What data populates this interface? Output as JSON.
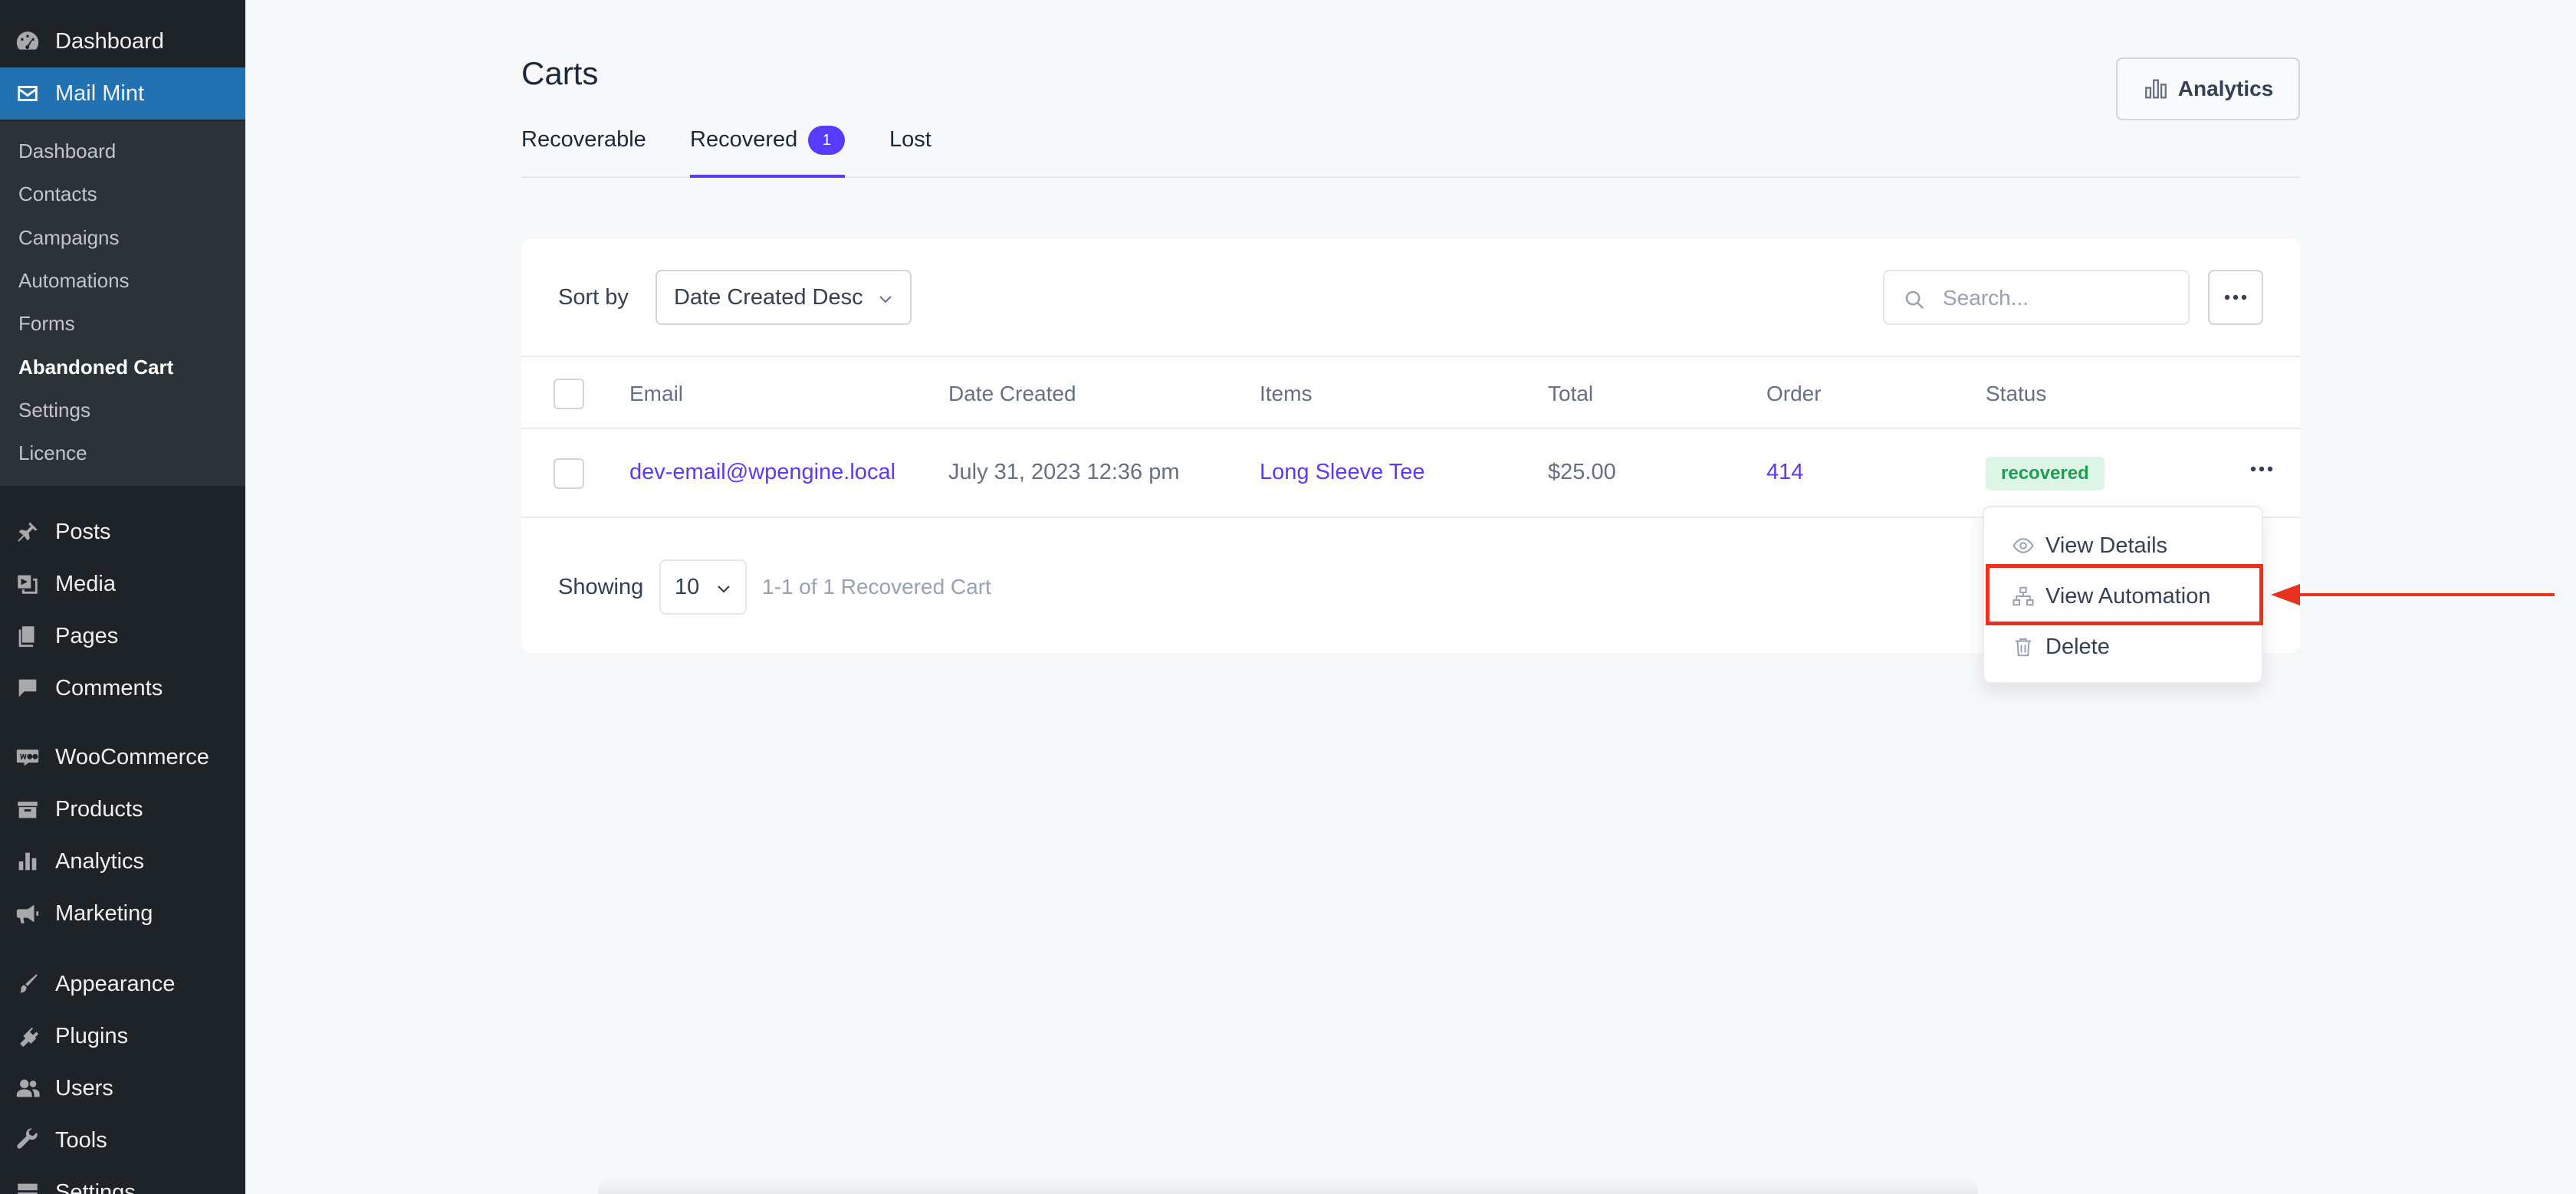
{
  "sidebar": {
    "top_items": [
      {
        "label": "Dashboard",
        "icon": "dashboard-icon"
      },
      {
        "label": "Mail Mint",
        "icon": "mail-icon",
        "active": true
      }
    ],
    "submenu": [
      "Dashboard",
      "Contacts",
      "Campaigns",
      "Automations",
      "Forms",
      "Abandoned Cart",
      "Settings",
      "Licence"
    ],
    "current_submenu": "Abandoned Cart",
    "items": [
      {
        "label": "Posts",
        "icon": "pin-icon"
      },
      {
        "label": "Media",
        "icon": "media-icon"
      },
      {
        "label": "Pages",
        "icon": "pages-icon"
      },
      {
        "label": "Comments",
        "icon": "comments-icon"
      },
      {
        "label": "WooCommerce",
        "icon": "woo-icon"
      },
      {
        "label": "Products",
        "icon": "products-icon"
      },
      {
        "label": "Analytics",
        "icon": "bar-chart-icon"
      },
      {
        "label": "Marketing",
        "icon": "megaphone-icon"
      },
      {
        "label": "Appearance",
        "icon": "brush-icon"
      },
      {
        "label": "Plugins",
        "icon": "plug-icon"
      },
      {
        "label": "Users",
        "icon": "users-icon"
      },
      {
        "label": "Tools",
        "icon": "wrench-icon"
      },
      {
        "label": "Settings",
        "icon": "settings-icon"
      }
    ]
  },
  "header": {
    "title": "Carts",
    "analytics_label": "Analytics"
  },
  "tabs": [
    {
      "label": "Recoverable"
    },
    {
      "label": "Recovered",
      "count": "1",
      "active": true
    },
    {
      "label": "Lost"
    }
  ],
  "toolbar": {
    "sort_label": "Sort by",
    "sort_value": "Date Created Desc",
    "search_placeholder": "Search..."
  },
  "table": {
    "columns": [
      "Email",
      "Date Created",
      "Items",
      "Total",
      "Order",
      "Status"
    ],
    "rows": [
      {
        "email": "dev-email@wpengine.local",
        "date_created": "July 31, 2023 12:36 pm",
        "items": "Long Sleeve Tee",
        "total": "$25.00",
        "order": "414",
        "status": "recovered"
      }
    ]
  },
  "pagination": {
    "showing_label": "Showing",
    "per_page": "10",
    "range_text": "1-1 of 1 Recovered Cart"
  },
  "row_menu": {
    "items": [
      {
        "label": "View Details",
        "icon": "eye-icon"
      },
      {
        "label": "View Automation",
        "icon": "sitemap-icon"
      },
      {
        "label": "Delete",
        "icon": "trash-icon"
      }
    ],
    "highlighted": "View Automation"
  },
  "colors": {
    "accent": "#573bff",
    "sidebar_bg": "#1d2327",
    "sidebar_active": "#2271b1",
    "status_bg": "#dcf5e6",
    "status_text": "#1e9e55",
    "annotation": "#e8321f"
  }
}
